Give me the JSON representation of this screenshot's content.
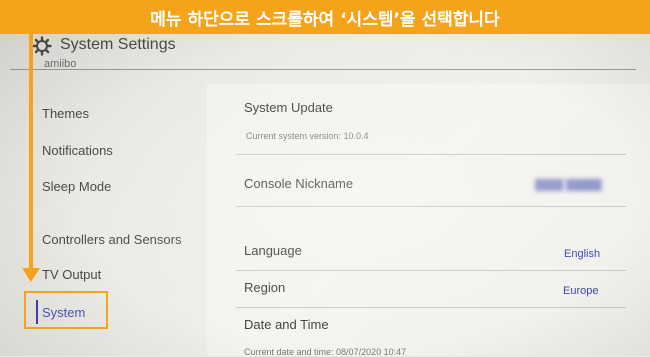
{
  "banner": {
    "text": "메뉴 하단으로 스크롤하여 ‘시스템’을 선택합니다"
  },
  "header": {
    "title": "System Settings",
    "icon": "gear-icon"
  },
  "sidebar": {
    "clipped_item": "amiibo",
    "items": [
      {
        "label": "Themes"
      },
      {
        "label": "Notifications"
      },
      {
        "label": "Sleep Mode"
      },
      {
        "label": "Controllers and Sensors"
      },
      {
        "label": "TV Output"
      },
      {
        "label": "System",
        "selected": true
      }
    ]
  },
  "main": {
    "system_update": {
      "title": "System Update",
      "subtitle": "Current system version: 10.0.4"
    },
    "console_nickname": {
      "title": "Console Nickname"
    },
    "language": {
      "title": "Language",
      "value": "English"
    },
    "region": {
      "title": "Region",
      "value": "Europe"
    },
    "date_time": {
      "title": "Date and Time",
      "subtitle": "Current date and time: 08/07/2020 10:47"
    }
  },
  "colors": {
    "accent": "#f5a31a",
    "selection": "#3b46b0",
    "value_text": "#3b48b0"
  }
}
